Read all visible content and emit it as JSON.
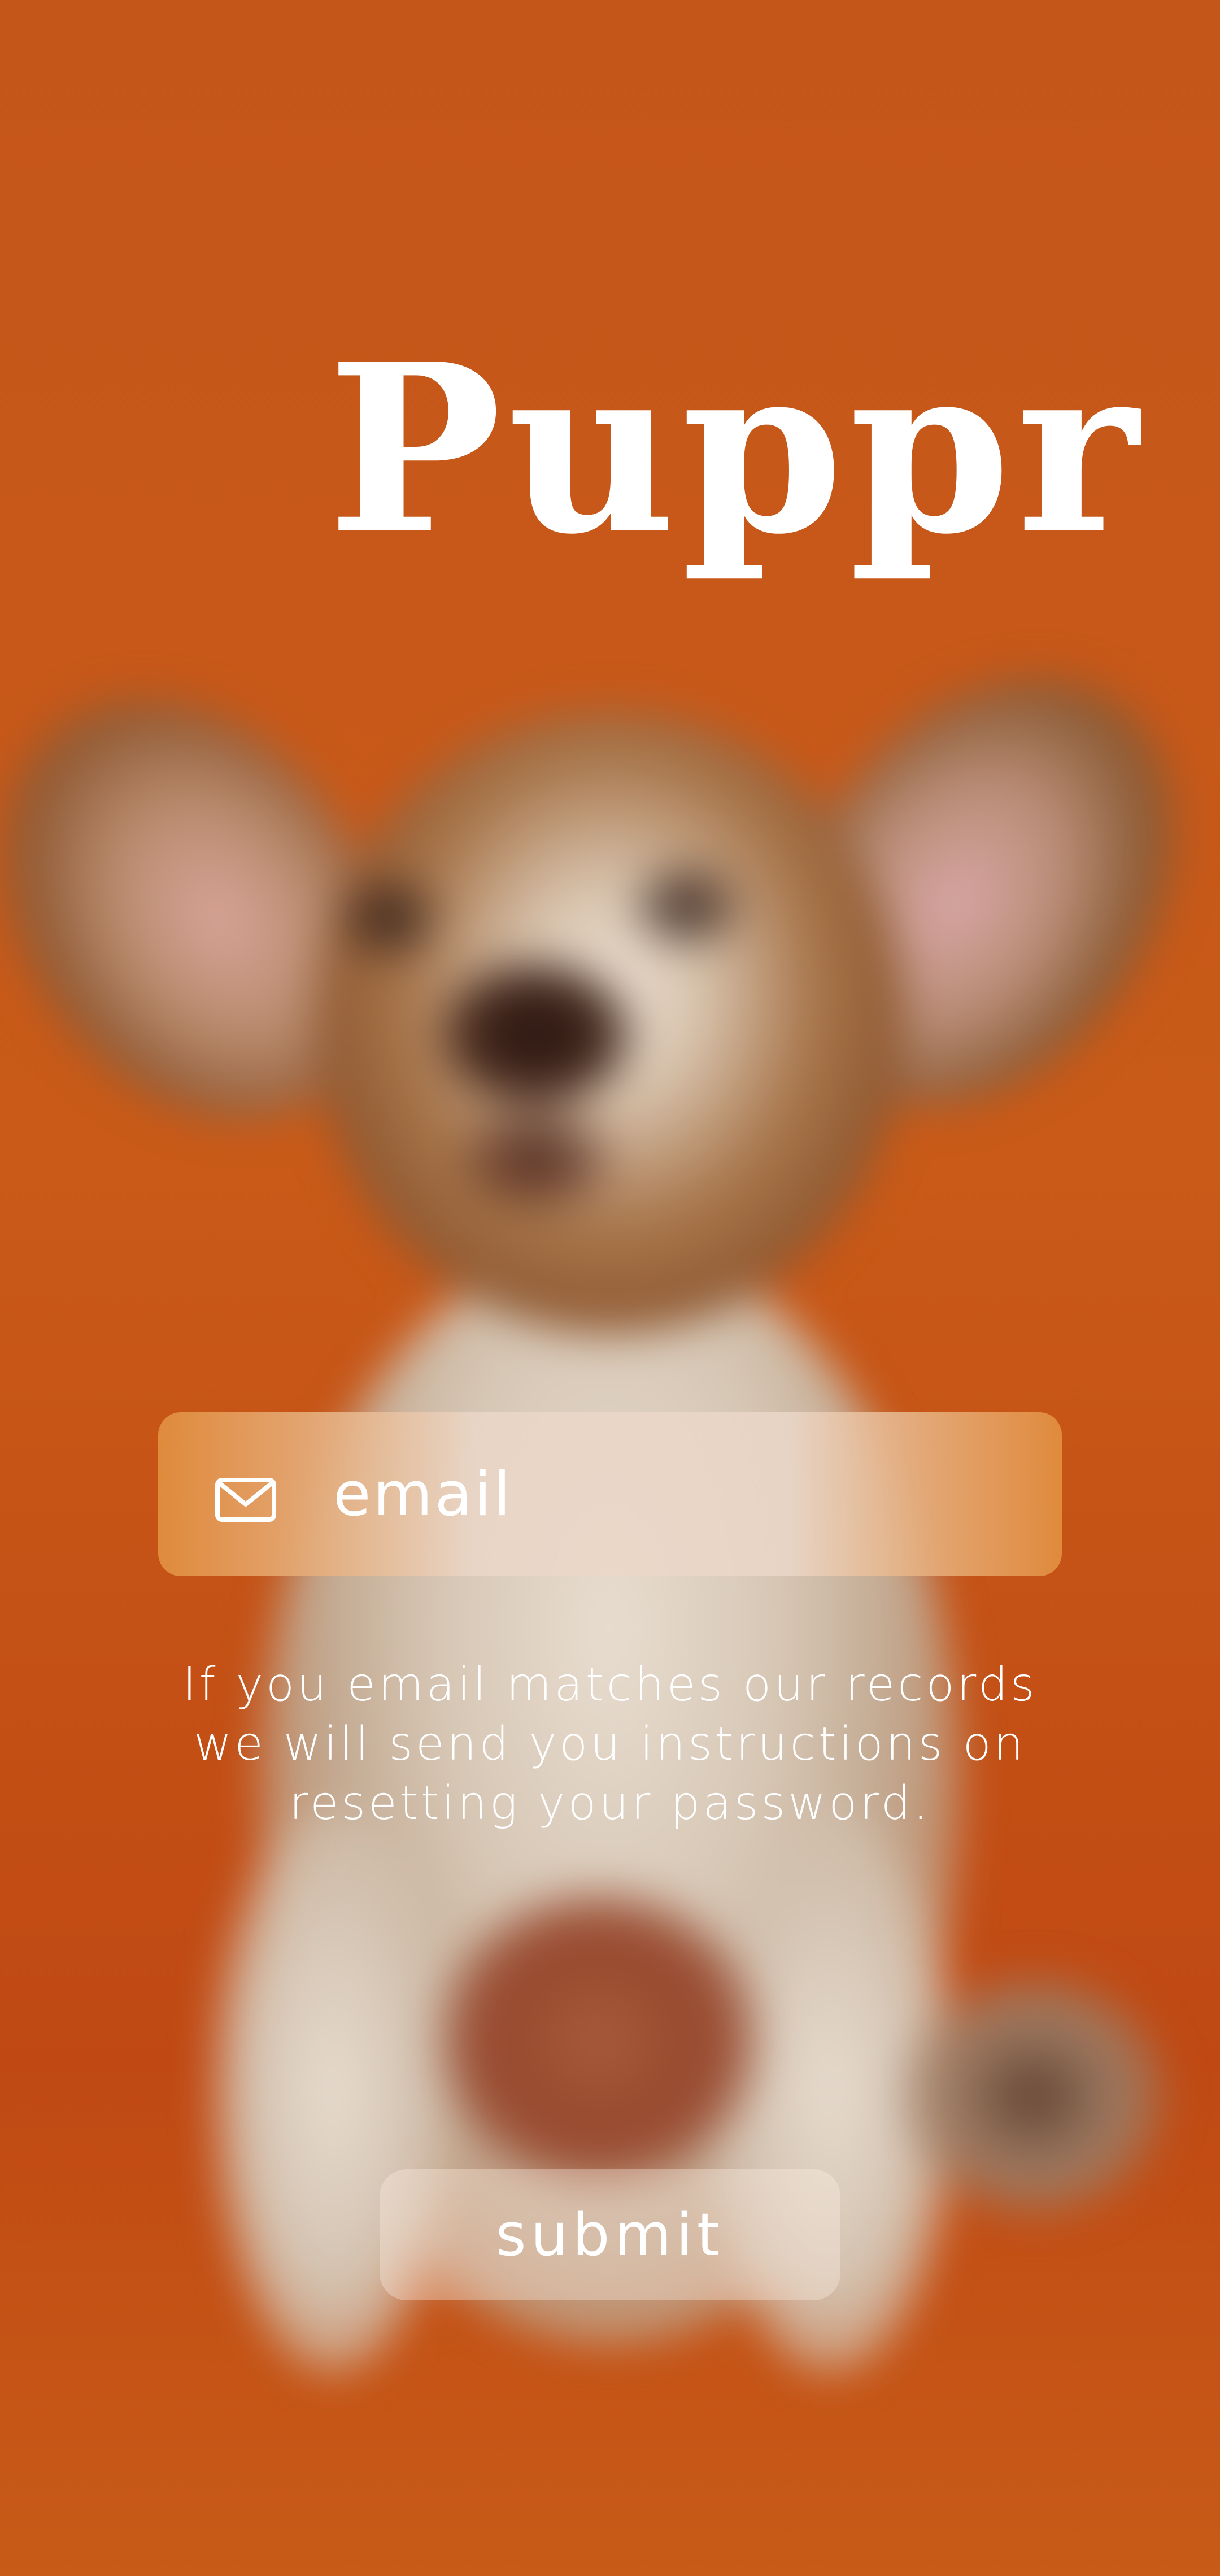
{
  "app": {
    "title": "Puppr"
  },
  "form": {
    "email_placeholder": "email",
    "email_value": "",
    "info_text": "If you email matches our records we will send you instructions   on resetting your password.",
    "submit_label": "submit"
  },
  "icons": {
    "email_field_icon": "mail-icon"
  },
  "colors": {
    "background": "#c9551a",
    "text": "#ffffff",
    "field_accent": "#e08a3c"
  }
}
